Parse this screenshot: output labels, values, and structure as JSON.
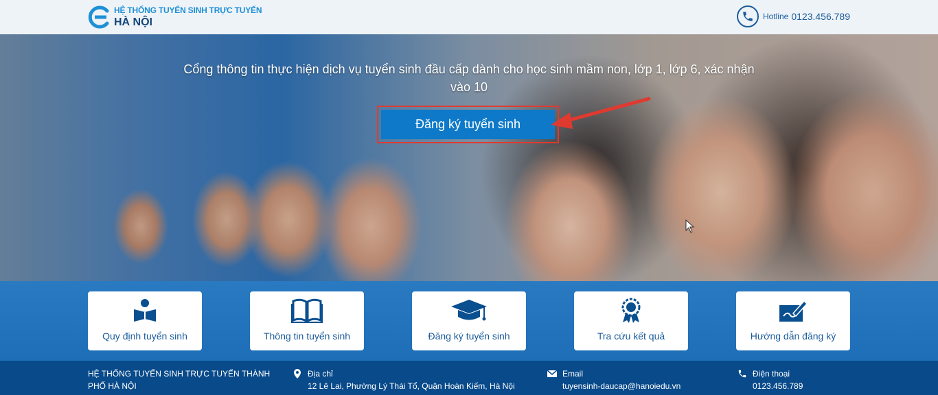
{
  "header": {
    "logo_line1": "HỆ THỐNG TUYỂN SINH TRỰC TUYẾN",
    "logo_line2": "HÀ NỘI",
    "hotline_label": "Hotline",
    "hotline_number": "0123.456.789"
  },
  "hero": {
    "headline": "Cổng thông tin thực hiện dịch vụ tuyển sinh đầu cấp dành cho học sinh mầm non, lớp 1, lớp 6, xác nhận vào 10",
    "cta_label": "Đăng ký tuyển sinh"
  },
  "cards": [
    {
      "label": "Quy định tuyển sinh",
      "icon": "reader-book-icon"
    },
    {
      "label": "Thông tin tuyển sinh",
      "icon": "open-book-icon"
    },
    {
      "label": "Đăng ký tuyển sinh",
      "icon": "graduation-cap-icon"
    },
    {
      "label": "Tra cứu kết quả",
      "icon": "award-badge-icon"
    },
    {
      "label": "Hướng dẫn đăng ký",
      "icon": "pen-sign-icon"
    }
  ],
  "footer": {
    "org_name": "HỆ THỐNG TUYỂN SINH TRỰC TUYẾN THÀNH PHỐ HÀ NỘI",
    "address_title": "Địa chỉ",
    "address_value": "12 Lê Lai, Phường Lý Thái Tổ, Quận Hoàn Kiếm, Hà Nội",
    "email_title": "Email",
    "email_value": "tuyensinh-daucap@hanoiedu.vn",
    "phone_title": "Điện thoại",
    "phone_value": "0123.456.789"
  },
  "colors": {
    "brand_blue": "#0d79c8",
    "dark_blue": "#084a8a",
    "highlight_red": "#e03a30"
  }
}
